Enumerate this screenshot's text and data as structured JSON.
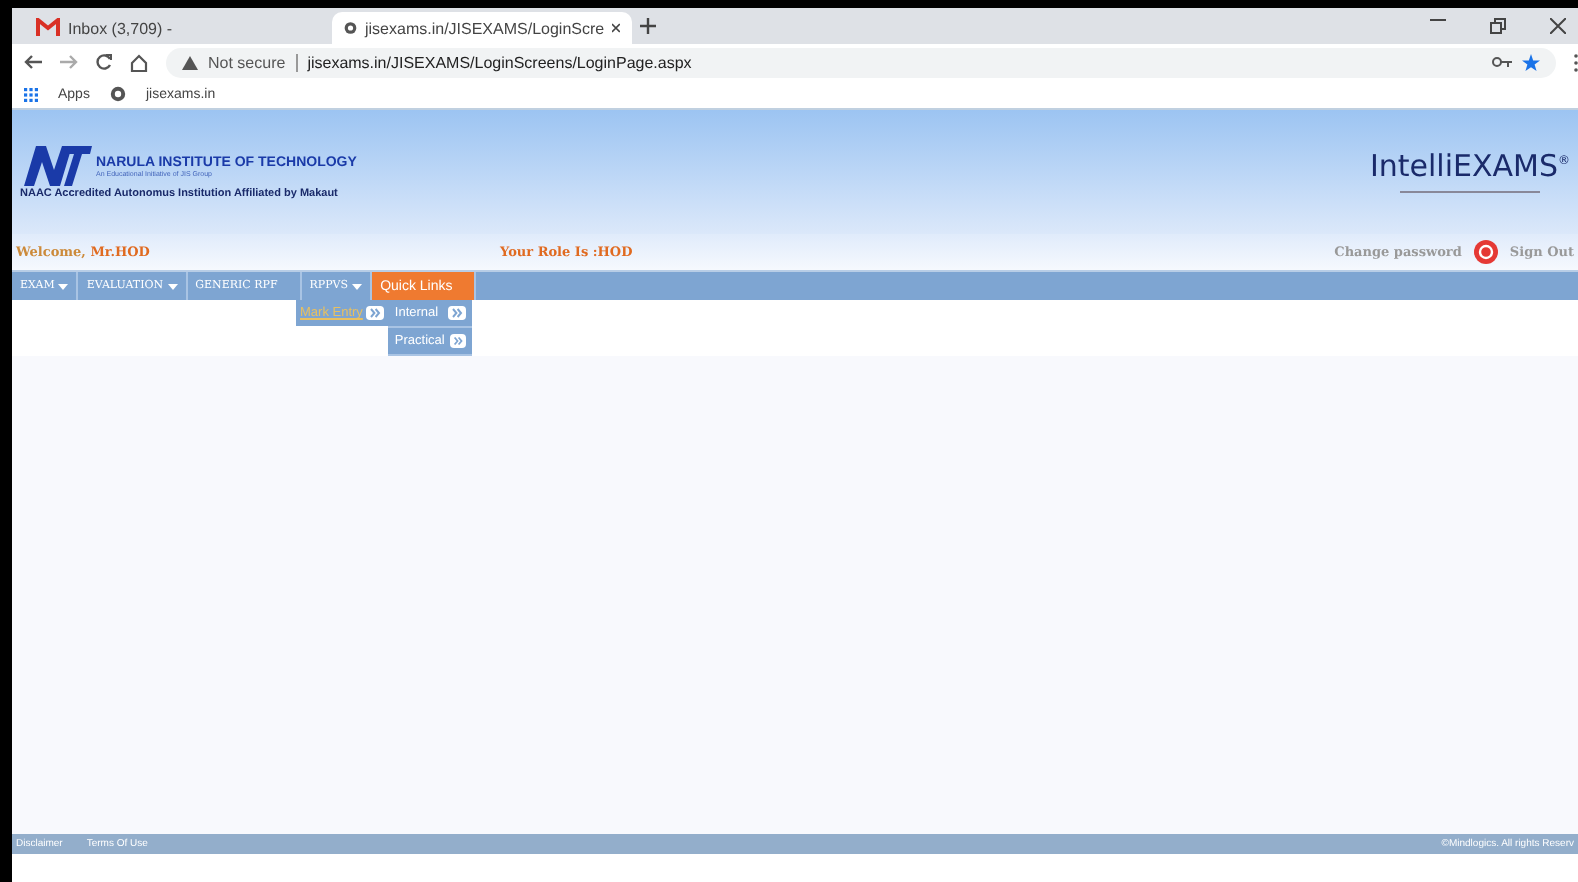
{
  "browser": {
    "tabs": [
      {
        "kind": "mail",
        "label": "Inbox (3,709) -",
        "selected": false
      },
      {
        "kind": "site",
        "label": "jisexams.in/JISEXAMS/LoginScre",
        "selected": true
      }
    ],
    "address": {
      "warning": "Not secure",
      "url": "jisexams.in/JISEXAMS/LoginScreens/LoginPage.aspx"
    },
    "bookmarks": [
      "Apps",
      "jisexams.in"
    ]
  },
  "header": {
    "institute": "NARULA INSTITUTE OF TECHNOLOGY",
    "initiative": "An Educational Initiative of JIS Group",
    "accreditation": "NAAC Accredited Autonomus Institution Affiliated by Makaut",
    "product": "IntelliEXAMS",
    "registered": "®"
  },
  "user_bar": {
    "welcome": "Welcome,",
    "user": "Mr.HOD",
    "role": "Your Role Is :HOD",
    "change_password": "Change password",
    "sign_out": "Sign Out"
  },
  "menu": [
    {
      "label": "EXAM",
      "caret": true,
      "selected": false
    },
    {
      "label": "EVALUATION",
      "caret": true,
      "selected": false
    },
    {
      "label": "GENERIC RPF",
      "caret": false,
      "selected": false
    },
    {
      "label": "RPPVS",
      "caret": true,
      "selected": false
    },
    {
      "label": "Quick Links",
      "caret": false,
      "selected": true
    }
  ],
  "submenu": {
    "item": "Mark Entry",
    "children": [
      "Internal",
      "Practical"
    ]
  },
  "footer": {
    "links": [
      "Disclaimer",
      "Terms Of Use"
    ],
    "copyright": "©Mindlogics. All rights Reserv"
  }
}
